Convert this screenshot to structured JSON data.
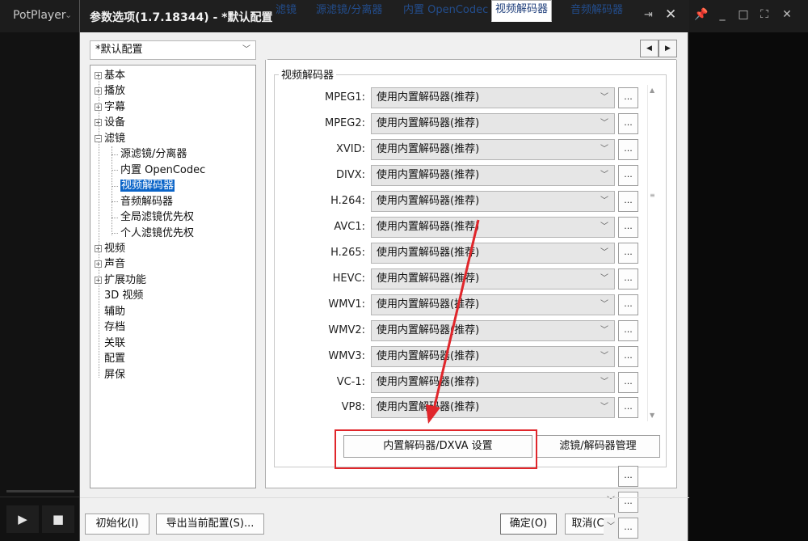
{
  "player": {
    "title": "PotPlayer",
    "title_chevron": "⌄",
    "controls": [
      "📌",
      "_",
      "□",
      "⛶",
      "✕"
    ],
    "play_icon": "▶",
    "stop_icon": "■"
  },
  "dialog": {
    "title": "参数选项(1.7.18344) - *默认配置",
    "pin_icon": "⇥",
    "close_icon": "✕",
    "preset": "*默认配置",
    "tree": [
      {
        "label": "基本",
        "expander": "+"
      },
      {
        "label": "播放",
        "expander": "+"
      },
      {
        "label": "字幕",
        "expander": "+"
      },
      {
        "label": "设备",
        "expander": "+"
      },
      {
        "label": "滤镜",
        "expander": "−"
      },
      {
        "label": "源滤镜/分离器",
        "child": true
      },
      {
        "label": "内置 OpenCodec",
        "child": true
      },
      {
        "label": "视频解码器",
        "child": true,
        "selected": true
      },
      {
        "label": "音频解码器",
        "child": true
      },
      {
        "label": "全局滤镜优先权",
        "child": true
      },
      {
        "label": "个人滤镜优先权",
        "child": true
      },
      {
        "label": "视频",
        "expander": "+"
      },
      {
        "label": "声音",
        "expander": "+"
      },
      {
        "label": "扩展功能",
        "expander": "+"
      },
      {
        "label": "3D 视频"
      },
      {
        "label": "辅助"
      },
      {
        "label": "存档"
      },
      {
        "label": "关联"
      },
      {
        "label": "配置"
      },
      {
        "label": "屏保"
      }
    ],
    "tabs": [
      "滤镜",
      "源滤镜/分离器",
      "内置 OpenCodec",
      "视频解码器",
      "音频解码器"
    ],
    "active_tab": "视频解码器",
    "group_title": "视频解码器",
    "decoder_option": "使用内置解码器(推荐)",
    "dots_label": "...",
    "codecs": [
      "MPEG1:",
      "MPEG2:",
      "XVID:",
      "DIVX:",
      "H.264:",
      "AVC1:",
      "H.265:",
      "HEVC:",
      "WMV1:",
      "WMV2:",
      "WMV3:",
      "VC-1:",
      "VP8:"
    ],
    "dxva_button": "内置解码器/DXVA 设置",
    "filter_manager_button": "滤镜/解码器管理",
    "buttons": {
      "reset": "初始化(I)",
      "export": "导出当前配置(S)...",
      "ok": "确定(O)",
      "cancel": "取消(C)"
    },
    "accent_colors": {
      "highlight_box": "#e0262b",
      "selection": "#0a64c8"
    }
  }
}
